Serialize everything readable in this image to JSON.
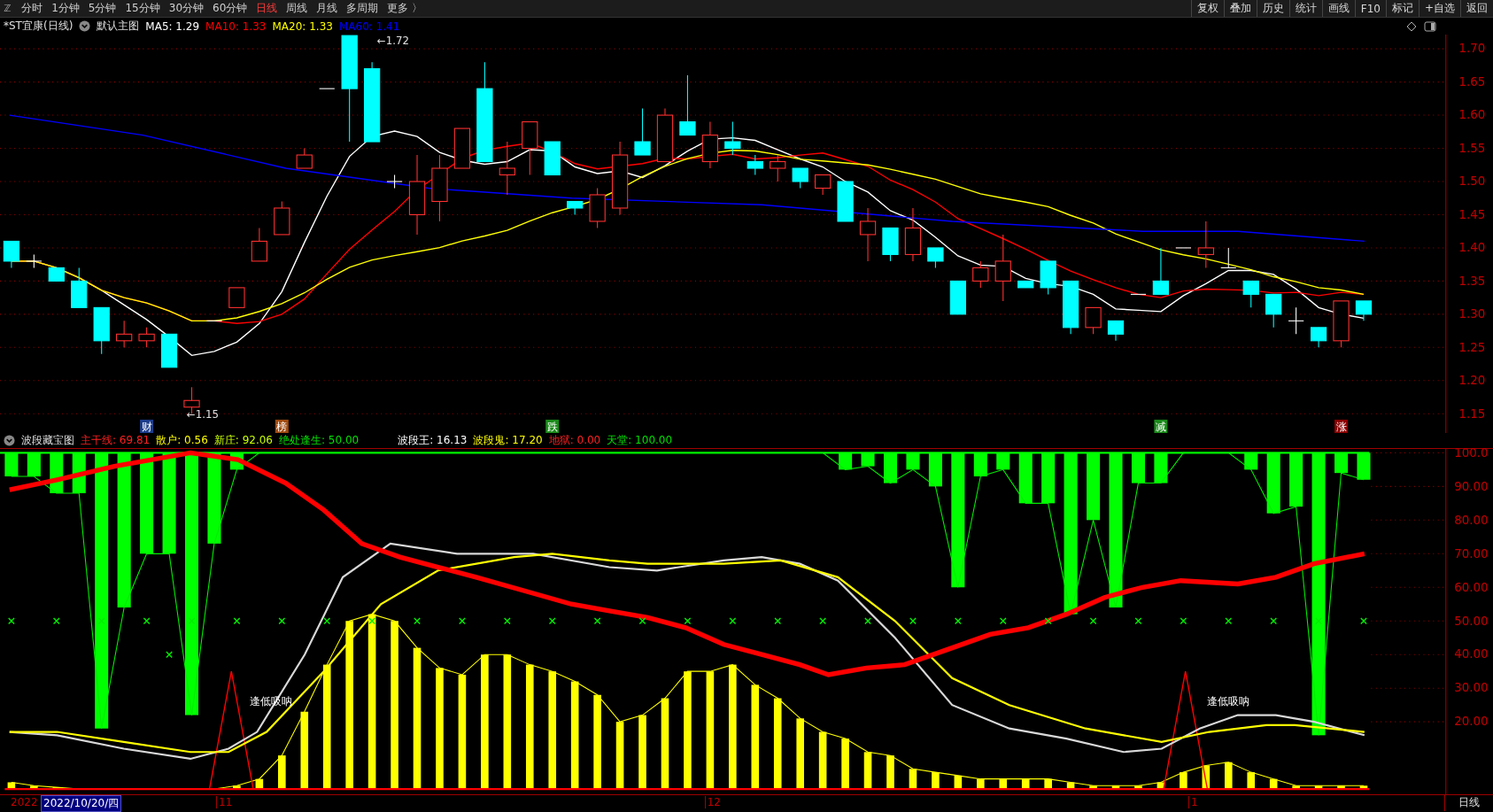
{
  "toolbar": {
    "menu_icon_label": "ℤ",
    "periods": [
      {
        "label": "分时",
        "selected": false
      },
      {
        "label": "1分钟",
        "selected": false
      },
      {
        "label": "5分钟",
        "selected": false
      },
      {
        "label": "15分钟",
        "selected": false
      },
      {
        "label": "30分钟",
        "selected": false
      },
      {
        "label": "60分钟",
        "selected": false
      },
      {
        "label": "日线",
        "selected": true
      },
      {
        "label": "周线",
        "selected": false
      },
      {
        "label": "月线",
        "selected": false
      },
      {
        "label": "多周期",
        "selected": false
      },
      {
        "label": "更多 〉",
        "selected": false
      }
    ],
    "tools": [
      "复权",
      "叠加",
      "历史",
      "统计",
      "画线",
      "F10",
      "标记",
      "+自选",
      "返回"
    ]
  },
  "main_chart": {
    "title": "*ST宜康(日线)",
    "template": "默认主图",
    "averages": [
      {
        "label": "MA5: 1.29",
        "color": "#ffffff"
      },
      {
        "label": "MA10: 1.33",
        "color": "#ff0000"
      },
      {
        "label": "MA20: 1.33",
        "color": "#ffff00"
      },
      {
        "label": "MA60: 1.41",
        "color": "#0000ff"
      }
    ],
    "price_ticks": [
      "1.70",
      "1.65",
      "1.60",
      "1.55",
      "1.50",
      "1.45",
      "1.40",
      "1.35",
      "1.30",
      "1.25",
      "1.20",
      "1.15"
    ],
    "high_label": "←1.72",
    "low_label": "←1.15",
    "signals": [
      {
        "label": "财",
        "color": "#1c3c8c"
      },
      {
        "label": "榜",
        "color": "#a04a10"
      },
      {
        "label": "跌",
        "color": "#1a8a1a"
      },
      {
        "label": "减",
        "color": "#1a8a1a"
      },
      {
        "label": "涨",
        "color": "#8b0000"
      }
    ]
  },
  "indicator": {
    "name": "波段藏宝图",
    "lines": [
      {
        "label": "主干线: 69.81",
        "color": "#ff2020"
      },
      {
        "label": "散户: 0.56",
        "color": "#ffff00"
      },
      {
        "label": "新庄: 92.06",
        "color": "#c8ff00"
      },
      {
        "label": "绝处逢生: 50.00",
        "color": "#00e000"
      }
    ],
    "lines_2": [
      {
        "label": "波段王: 16.13",
        "color": "#ffffff"
      },
      {
        "label": "波段鬼: 17.20",
        "color": "#ffff00"
      },
      {
        "label": "地狱: 0.00",
        "color": "#ff2020"
      },
      {
        "label": "天堂: 100.00",
        "color": "#00e000"
      }
    ],
    "ticks": [
      "100.0",
      "90.00",
      "80.00",
      "70.00",
      "60.00",
      "50.00",
      "40.00",
      "30.00",
      "20.00"
    ],
    "annotations": [
      "逢低吸呐",
      "逢低吸呐"
    ]
  },
  "date_bar": {
    "year": "2022",
    "cursor_date": "2022/10/20/四",
    "months": [
      "11",
      "12",
      "1"
    ],
    "period": "日线"
  }
}
